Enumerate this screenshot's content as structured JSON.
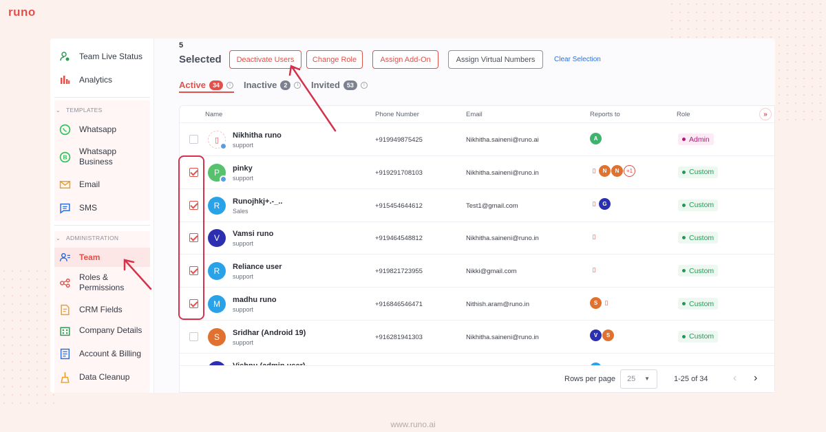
{
  "brand": "runo",
  "footer_url": "www.runo.ai",
  "colors": {
    "accent": "#e2504a",
    "custom_role": "#1f9b55",
    "admin_role": "#b5167a"
  },
  "sidebar": {
    "items_top": [
      {
        "label": "Team Live Status",
        "icon": "user-live-icon"
      },
      {
        "label": "Analytics",
        "icon": "bar-chart-icon"
      }
    ],
    "templates_section": "TEMPLATES",
    "templates": [
      {
        "label": "Whatsapp",
        "icon": "whatsapp-icon"
      },
      {
        "label": "Whatsapp Business",
        "icon": "whatsapp-business-icon"
      },
      {
        "label": "Email",
        "icon": "mail-icon"
      },
      {
        "label": "SMS",
        "icon": "message-icon"
      }
    ],
    "admin_section": "ADMINISTRATION",
    "admin": [
      {
        "label": "Team",
        "icon": "team-icon",
        "active": true
      },
      {
        "label": "Roles & Permissions",
        "icon": "roles-icon"
      },
      {
        "label": "CRM Fields",
        "icon": "crm-fields-icon"
      },
      {
        "label": "Company Details",
        "icon": "building-icon"
      },
      {
        "label": "Account & Billing",
        "icon": "billing-icon"
      },
      {
        "label": "Data Cleanup",
        "icon": "broom-icon"
      }
    ]
  },
  "toolbar": {
    "selected_count": "5",
    "selected_label": "Selected",
    "deactivate": "Deactivate Users",
    "change_role": "Change Role",
    "assign_addon": "Assign Add-On",
    "assign_numbers": "Assign Virtual Numbers",
    "clear": "Clear Selection"
  },
  "tabs": [
    {
      "label": "Active",
      "count": "34"
    },
    {
      "label": "Inactive",
      "count": "2"
    },
    {
      "label": "Invited",
      "count": "53"
    }
  ],
  "table": {
    "headers": {
      "name": "Name",
      "phone": "Phone Number",
      "email": "Email",
      "reports": "Reports to",
      "role": "Role"
    },
    "rows": [
      {
        "name": "Nikhitha runo",
        "team": "support",
        "phone": "+919949875425",
        "email": "Nikhitha.saineni@runo.ai",
        "role": "Admin",
        "checked": false,
        "avatar": "",
        "avatar_color": "",
        "reports": [
          {
            "t": "A",
            "c": "#3db46d"
          }
        ]
      },
      {
        "name": "pinky",
        "team": "support",
        "phone": "+919291708103",
        "email": "Nikhitha.saineni@runo.in",
        "role": "Custom",
        "checked": true,
        "avatar": "P",
        "avatar_color": "#56c26d",
        "reports": [
          {
            "t": "phone"
          },
          {
            "t": "N",
            "c": "#e0712f"
          },
          {
            "t": "N",
            "c": "#e0712f"
          },
          {
            "t": "+1",
            "plus": true
          }
        ]
      },
      {
        "name": "Runojhkj+.-_..",
        "team": "Sales",
        "phone": "+915454644612",
        "email": "Test1@gmail.com",
        "role": "Custom",
        "checked": true,
        "avatar": "R",
        "avatar_color": "#2aa2e8",
        "reports": [
          {
            "t": "phone"
          },
          {
            "t": "G",
            "c": "#2b2fb0"
          }
        ]
      },
      {
        "name": "Vamsi runo",
        "team": "support",
        "phone": "+919464548812",
        "email": "Nikhitha.saineni@runo.in",
        "role": "Custom",
        "checked": true,
        "avatar": "V",
        "avatar_color": "#2b2fb0",
        "reports": [
          {
            "t": "phone"
          }
        ]
      },
      {
        "name": "Reliance user",
        "team": "support",
        "phone": "+919821723955",
        "email": "Nikki@gmail.com",
        "role": "Custom",
        "checked": true,
        "avatar": "R",
        "avatar_color": "#2aa2e8",
        "reports": [
          {
            "t": "phone"
          }
        ]
      },
      {
        "name": "madhu runo",
        "team": "support",
        "phone": "+916846546471",
        "email": "Nithish.aram@runo.in",
        "role": "Custom",
        "checked": true,
        "avatar": "M",
        "avatar_color": "#2aa2e8",
        "reports": [
          {
            "t": "S",
            "c": "#e0712f"
          },
          {
            "t": "phone"
          }
        ]
      },
      {
        "name": "Sridhar (Android 19)",
        "team": "support",
        "phone": "+916281941303",
        "email": "Nikhitha.saineni@runo.in",
        "role": "Custom",
        "checked": false,
        "avatar": "S",
        "avatar_color": "#e0712f",
        "reports": [
          {
            "t": "V",
            "c": "#2b2fb0"
          },
          {
            "t": "S",
            "c": "#e0712f"
          }
        ]
      },
      {
        "name": "Vishnu (admin user)",
        "team": "",
        "phone": "",
        "email": "",
        "role": "",
        "checked": false,
        "avatar": "",
        "avatar_color": "#2b2fb0",
        "reports": [
          {
            "t": "",
            "c": "#2aa2e8"
          }
        ]
      }
    ]
  },
  "pagination": {
    "rows_per_page_label": "Rows per page",
    "rows_per_page": "25",
    "range": "1-25 of 34"
  }
}
